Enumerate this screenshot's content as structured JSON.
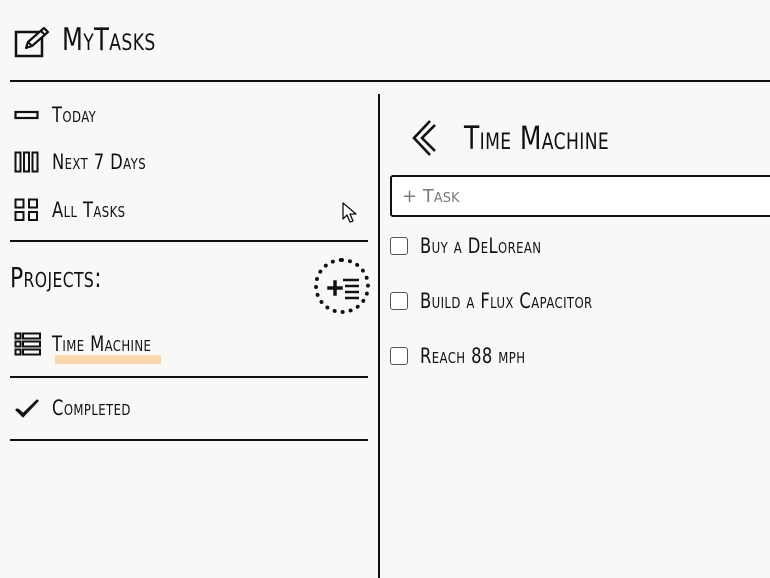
{
  "app": {
    "title": "MyTasks",
    "logo_icon": "edit-note-icon"
  },
  "sidebar": {
    "nav_items": [
      {
        "label": "Today",
        "icon": "single-bar-icon"
      },
      {
        "label": "Next 7 Days",
        "icon": "three-columns-icon"
      },
      {
        "label": "All Tasks",
        "icon": "grid-icon"
      }
    ],
    "projects_heading": "Projects:",
    "add_project_icon": "add-list-icon",
    "projects": [
      {
        "label": "Time Machine",
        "icon": "list-icon",
        "selected": true
      }
    ],
    "completed": {
      "label": "Completed",
      "icon": "checkmark-icon"
    }
  },
  "main": {
    "back_icon": "chevron-left-icon",
    "project_title": "Time Machine",
    "task_input": {
      "placeholder": "+ Task",
      "value": ""
    },
    "tasks": [
      {
        "label": "Buy a DeLorean",
        "checked": false
      },
      {
        "label": "Build a Flux Capacitor",
        "checked": false
      },
      {
        "label": "Reach 88 mph",
        "checked": false
      }
    ]
  },
  "colors": {
    "background": "#f8f8f6",
    "ink": "#111111",
    "selected_highlight": "#fbd7ac"
  }
}
